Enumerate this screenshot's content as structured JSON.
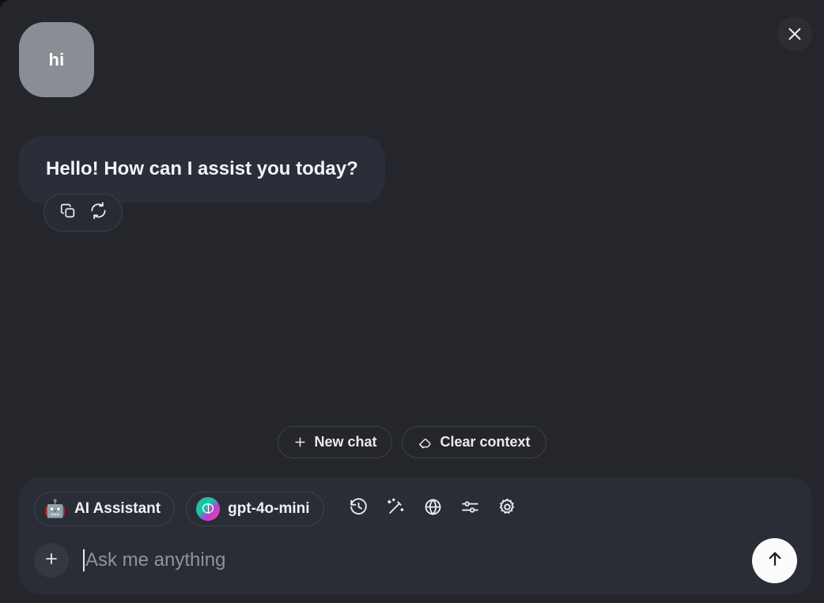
{
  "window": {
    "close_label": "×",
    "bg_color": "#24262b",
    "panel_radius": "14px"
  },
  "conversation": {
    "user_message": {
      "text": "hi",
      "bubble_color": "#898d94"
    },
    "assistant_message": {
      "text": "Hello! How can I assist you today?",
      "bubble_color": "#2b2e38",
      "actions": [
        {
          "name": "copy-icon",
          "label": "Copy"
        },
        {
          "name": "regenerate-icon",
          "label": "Regenerate"
        }
      ]
    }
  },
  "quick_actions": [
    {
      "label": "New chat",
      "icon": "plus-icon"
    },
    {
      "label": "Clear context",
      "icon": "eraser-icon"
    }
  ],
  "composer": {
    "assistant_pill": {
      "label": "AI Assistant",
      "icon": "robot-icon",
      "emoji": "🤖"
    },
    "model_pill": {
      "label": "gpt-4o-mini",
      "icon": "brain-icon",
      "gradient_start": "#13c5a4",
      "gradient_end": "#ef4b93"
    },
    "tools": [
      {
        "name": "history-icon",
        "label": "History"
      },
      {
        "name": "magic-wand-icon",
        "label": "Prompt enhance"
      },
      {
        "name": "globe-icon",
        "label": "Web search"
      },
      {
        "name": "sliders-icon",
        "label": "Parameters"
      },
      {
        "name": "gear-icon",
        "label": "Settings"
      }
    ],
    "attach": {
      "label": "+",
      "icon": "plus-icon"
    },
    "input": {
      "value": "",
      "placeholder": "Ask me anything"
    },
    "send": {
      "icon": "arrow-up-icon",
      "label": "Send"
    }
  }
}
